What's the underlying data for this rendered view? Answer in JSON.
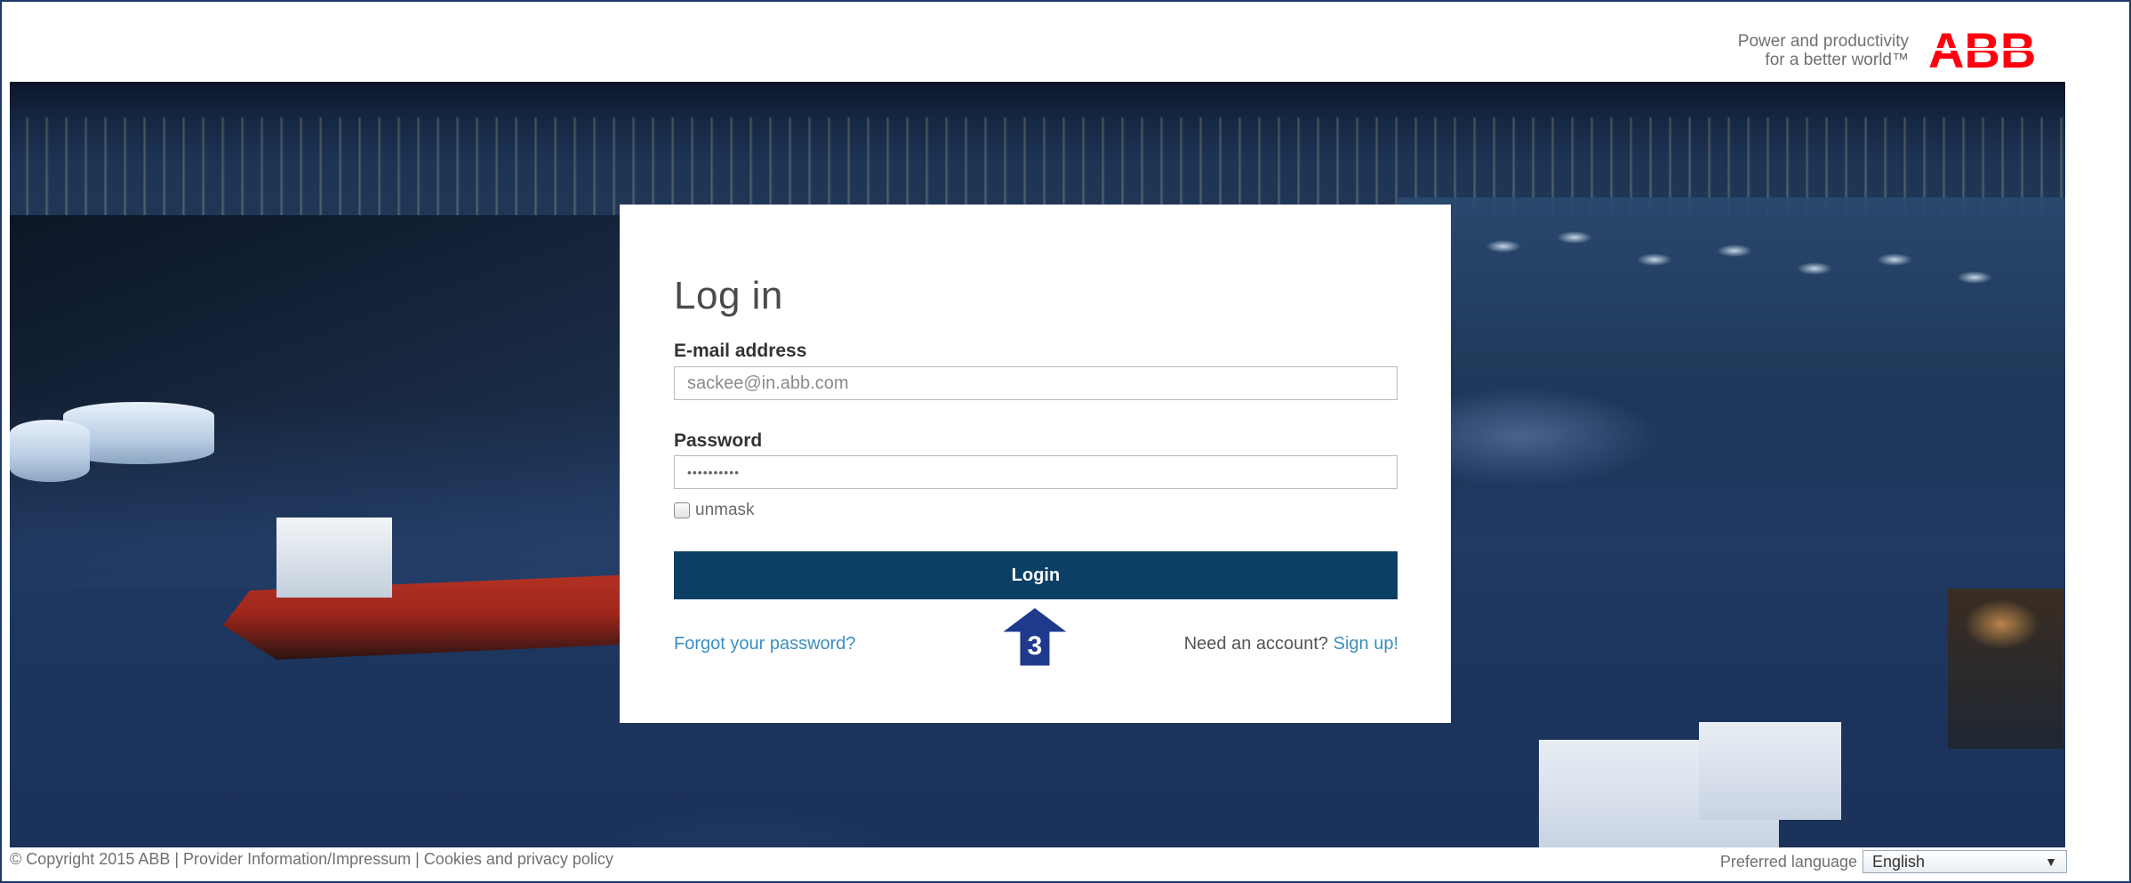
{
  "header": {
    "tagline_line1": "Power and productivity",
    "tagline_line2": "for a better world™",
    "logo_text": "ABB",
    "logo_color": "#ff000f"
  },
  "login": {
    "title": "Log in",
    "email_label": "E-mail address",
    "email_placeholder": "sackee@in.abb.com",
    "password_label": "Password",
    "password_value": "••••••••••",
    "unmask_label": "unmask",
    "login_button": "Login",
    "forgot_link": "Forgot your password?",
    "need_account_text": "Need an account?",
    "signup_link": "Sign up!"
  },
  "annotation": {
    "step_number": "3"
  },
  "footer": {
    "copyright": "© Copyright 2015 ABB | Provider Information/Impressum | Cookies and privacy policy",
    "language_label": "Preferred language",
    "language_value": "English"
  },
  "colors": {
    "button_bg": "#0b3f64",
    "link": "#3a8fbf",
    "frame_border": "#1f3a68"
  }
}
